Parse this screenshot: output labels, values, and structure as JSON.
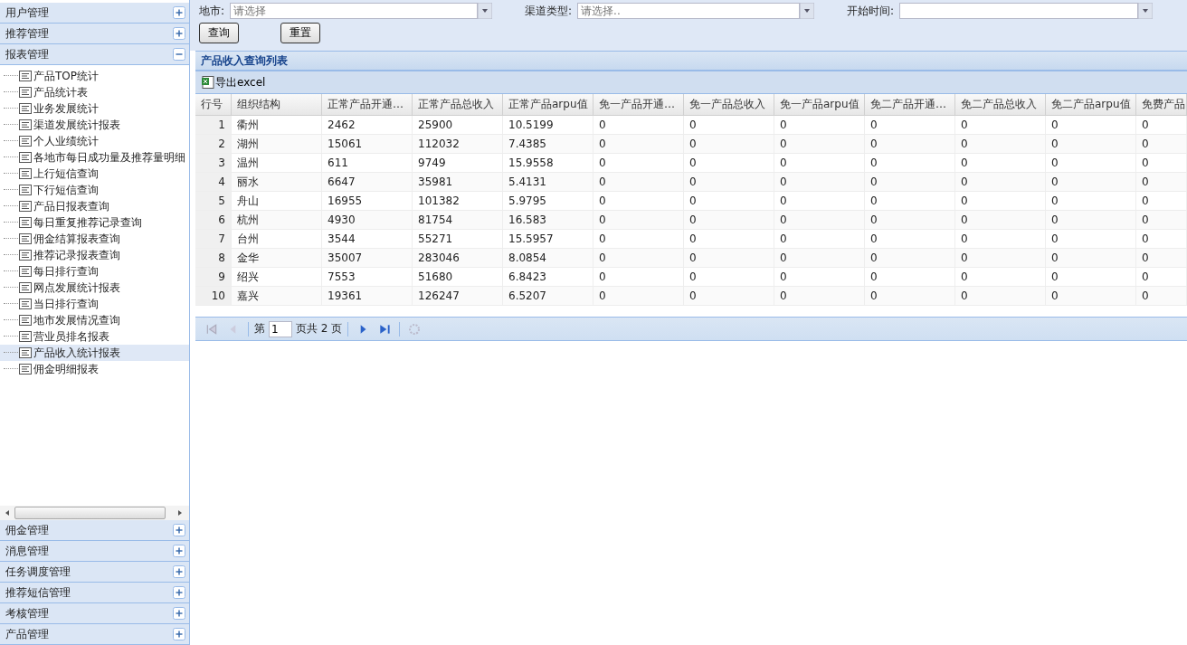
{
  "sidebar": {
    "sections": [
      {
        "title": "用户管理",
        "expanded": false
      },
      {
        "title": "推荐管理",
        "expanded": false
      },
      {
        "title": "报表管理",
        "expanded": true,
        "items": [
          {
            "label": "产品TOP统计",
            "selected": false
          },
          {
            "label": "产品统计表",
            "selected": false
          },
          {
            "label": "业务发展统计",
            "selected": false
          },
          {
            "label": "渠道发展统计报表",
            "selected": false
          },
          {
            "label": "个人业绩统计",
            "selected": false
          },
          {
            "label": "各地市每日成功量及推荐量明细",
            "selected": false
          },
          {
            "label": "上行短信查询",
            "selected": false
          },
          {
            "label": "下行短信查询",
            "selected": false
          },
          {
            "label": "产品日报表查询",
            "selected": false
          },
          {
            "label": "每日重复推荐记录查询",
            "selected": false
          },
          {
            "label": "佣金结算报表查询",
            "selected": false
          },
          {
            "label": "推荐记录报表查询",
            "selected": false
          },
          {
            "label": "每日排行查询",
            "selected": false
          },
          {
            "label": "网点发展统计报表",
            "selected": false
          },
          {
            "label": "当日排行查询",
            "selected": false
          },
          {
            "label": "地市发展情况查询",
            "selected": false
          },
          {
            "label": "营业员排名报表",
            "selected": false
          },
          {
            "label": "产品收入统计报表",
            "selected": true
          },
          {
            "label": "佣金明细报表",
            "selected": false
          }
        ]
      },
      {
        "title": "佣金管理",
        "expanded": false
      },
      {
        "title": "消息管理",
        "expanded": false
      },
      {
        "title": "任务调度管理",
        "expanded": false
      },
      {
        "title": "推荐短信管理",
        "expanded": false
      },
      {
        "title": "考核管理",
        "expanded": false
      },
      {
        "title": "产品管理",
        "expanded": false
      }
    ]
  },
  "filters": [
    {
      "label": "地市:",
      "placeholder": "请选择"
    },
    {
      "label": "渠道类型:",
      "placeholder": "请选择.."
    },
    {
      "label": "开始时间:"
    }
  ],
  "buttons": [
    "查询",
    "重置"
  ],
  "panel": {
    "title": "产品收入查询列表",
    "export": "导出excel"
  },
  "table": {
    "columns": [
      "行号",
      "组织结构",
      "正常产品开通…",
      "正常产品总收入",
      "正常产品arpu值",
      "免一产品开通…",
      "免一产品总收入",
      "免一产品arpu值",
      "免二产品开通…",
      "免二产品总收入",
      "免二产品arpu值",
      "免费产品"
    ],
    "rows": [
      [
        "1",
        "衢州",
        "2462",
        "25900",
        "10.5199",
        "0",
        "0",
        "0",
        "0",
        "0",
        "0",
        "0"
      ],
      [
        "2",
        "湖州",
        "15061",
        "112032",
        "7.4385",
        "0",
        "0",
        "0",
        "0",
        "0",
        "0",
        "0"
      ],
      [
        "3",
        "温州",
        "611",
        "9749",
        "15.9558",
        "0",
        "0",
        "0",
        "0",
        "0",
        "0",
        "0"
      ],
      [
        "4",
        "丽水",
        "6647",
        "35981",
        "5.4131",
        "0",
        "0",
        "0",
        "0",
        "0",
        "0",
        "0"
      ],
      [
        "5",
        "舟山",
        "16955",
        "101382",
        "5.9795",
        "0",
        "0",
        "0",
        "0",
        "0",
        "0",
        "0"
      ],
      [
        "6",
        "杭州",
        "4930",
        "81754",
        "16.583",
        "0",
        "0",
        "0",
        "0",
        "0",
        "0",
        "0"
      ],
      [
        "7",
        "台州",
        "3544",
        "55271",
        "15.5957",
        "0",
        "0",
        "0",
        "0",
        "0",
        "0",
        "0"
      ],
      [
        "8",
        "金华",
        "35007",
        "283046",
        "8.0854",
        "0",
        "0",
        "0",
        "0",
        "0",
        "0",
        "0"
      ],
      [
        "9",
        "绍兴",
        "7553",
        "51680",
        "6.8423",
        "0",
        "0",
        "0",
        "0",
        "0",
        "0",
        "0"
      ],
      [
        "10",
        "嘉兴",
        "19361",
        "126247",
        "6.5207",
        "0",
        "0",
        "0",
        "0",
        "0",
        "0",
        "0"
      ]
    ]
  },
  "pager": {
    "prefix": "第",
    "page": "1",
    "suffix": "页共 2 页"
  }
}
